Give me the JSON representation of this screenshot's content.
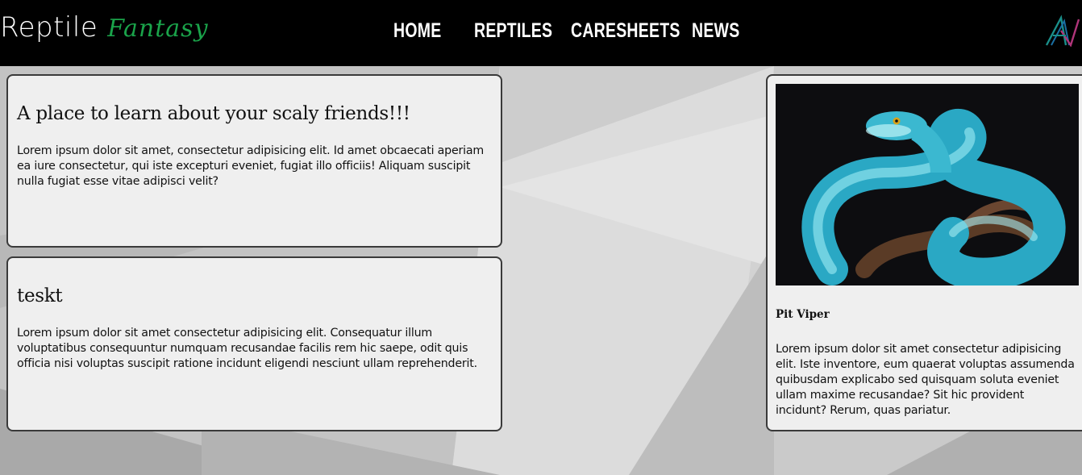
{
  "header": {
    "logo_main": "Reptile",
    "logo_accent": "Fantasy",
    "nav": [
      "HOME",
      "REPTILES",
      "CARESHEETS",
      "NEWS"
    ]
  },
  "cards": [
    {
      "title": "A place to learn about your scaly friends!!!",
      "body": "Lorem ipsum dolor sit amet, consectetur adipisicing elit. Id amet obcaecati aperiam ea iure consectetur, qui iste excepturi eveniet, fugiat illo officiis! Aliquam suscipit nulla fugiat esse vitae adipisci velit?"
    },
    {
      "title": "teskt",
      "body": "Lorem ipsum dolor sit amet consectetur adipisicing elit. Consequatur illum voluptatibus consequuntur numquam recusandae facilis rem hic saepe, odit quis officia nisi voluptas suscipit ratione incidunt eligendi nesciunt ullam reprehenderit."
    }
  ],
  "feature": {
    "image_alt": "snake-photo",
    "title": "Pit Viper",
    "body": "Lorem ipsum dolor sit amet consectetur adipisicing elit. Iste inventore, eum quaerat voluptas assumenda quibusdam explicabo sed quisquam soluta eveniet ullam maxime recusandae? Sit hic provident incidunt? Rerum, quas pariatur."
  },
  "colors": {
    "header_bg": "#000000",
    "accent_green": "#1aa34a",
    "card_bg": "#efefef"
  }
}
